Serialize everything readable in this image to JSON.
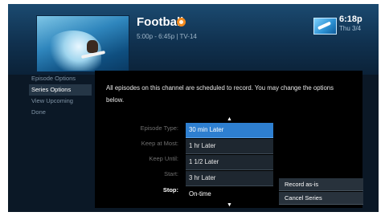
{
  "header": {
    "title": "Football",
    "subtitle": "5:00p - 6:45p | TV-14",
    "time": "6:18p",
    "date": "Thu 3/4"
  },
  "sidebar": {
    "items": [
      {
        "label": "Episode Options"
      },
      {
        "label": "Series Options"
      },
      {
        "label": "View Upcoming"
      },
      {
        "label": "Done"
      }
    ],
    "active": "Series Options"
  },
  "main": {
    "description": "All episodes on this channel are scheduled to record. You may change the options below.",
    "fields": [
      {
        "label": "Episode Type:"
      },
      {
        "label": "Keep at Most:"
      },
      {
        "label": "Keep Until:"
      },
      {
        "label": "Start:"
      },
      {
        "label": "Stop:"
      }
    ],
    "dropdown": {
      "up_arrow": "▲",
      "down_arrow": "▼",
      "options": [
        "30 min Later",
        "1 hr Later",
        "1 1/2 Later",
        "3 hr Later",
        "On-time"
      ],
      "selected": "30 min Later"
    }
  },
  "actions": {
    "record_label": "Record as-is",
    "cancel_label": "Cancel Series"
  },
  "icons": {
    "live": "live-indicator-icon",
    "provider": "provider-logo-icon"
  }
}
